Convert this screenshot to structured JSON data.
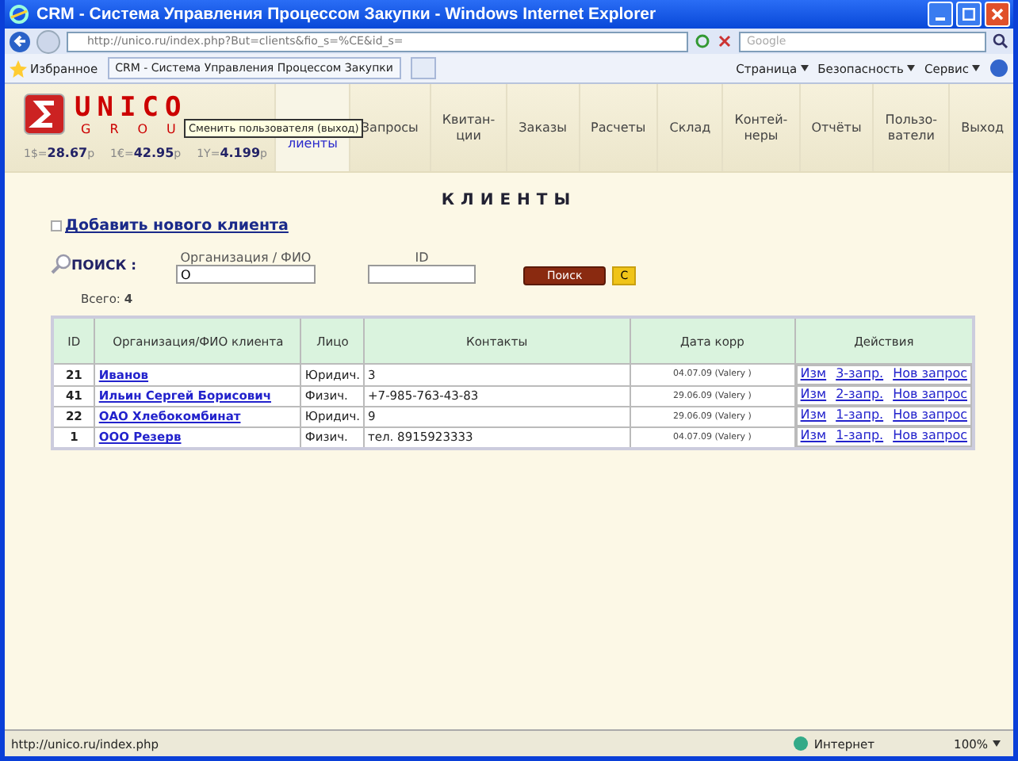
{
  "window": {
    "title": "CRM - Система Управления Процессом Закупки - Windows Internet Explorer"
  },
  "browser": {
    "address": "http://unico.ru/index.php?But=clients&fio_s=%CE&id_s=",
    "search_placeholder": "Google",
    "favorites": "Избранное",
    "tab_title": "CRM - Система Управления Процессом Закупки",
    "commands": [
      "Страница",
      "Безопасность",
      "Сервис"
    ]
  },
  "header": {
    "logo_main": "UNICO",
    "logo_sub": "GROU",
    "rates": [
      {
        "label": "1$=",
        "value": "28.67",
        "unit": "р"
      },
      {
        "label": "1€=",
        "value": "42.95",
        "unit": "р"
      },
      {
        "label": "1Y=",
        "value": "4.199",
        "unit": "р"
      }
    ],
    "tooltip": "Сменить пользователя (выход)",
    "nav": [
      {
        "label": "лиенты",
        "selected": true
      },
      {
        "label": "Запросы",
        "selected": false
      },
      {
        "label": "Квитан-\nции",
        "selected": false
      },
      {
        "label": "Заказы",
        "selected": false
      },
      {
        "label": "Расчеты",
        "selected": false
      },
      {
        "label": "Склад",
        "selected": false
      },
      {
        "label": "Контей-\nнеры",
        "selected": false
      },
      {
        "label": "Отчёты",
        "selected": false
      },
      {
        "label": "Пользо-\nватели",
        "selected": false
      },
      {
        "label": "Выход",
        "selected": false
      }
    ]
  },
  "page": {
    "title": "КЛИЕНТЫ",
    "add_link": "Добавить нового клиента",
    "search_label": "ПОИСК :",
    "org_label": "Организация / ФИО",
    "org_value": "О",
    "id_label": "ID",
    "search_button": "Поиск",
    "clear_button": "С",
    "total_label": "Всего:",
    "total_value": "4"
  },
  "table": {
    "columns": [
      "ID",
      "Организация/ФИО клиента",
      "Лицо",
      "Контакты",
      "Дата корр",
      "Действия"
    ],
    "rows": [
      {
        "id": "21",
        "name": "Иванов",
        "type": "Юридич.",
        "contacts": "3",
        "date": "04.07.09 (Valery )",
        "edit": "Изм",
        "requests": "3-запр.",
        "new": "Нов запрос"
      },
      {
        "id": "41",
        "name": "Ильин Сергей Борисович",
        "type": "Физич.",
        "contacts": "+7-985-763-43-83",
        "date": "29.06.09 (Valery )",
        "edit": "Изм",
        "requests": "2-запр.",
        "new": "Нов запрос"
      },
      {
        "id": "22",
        "name": "ОАО Хлебокомбинат",
        "type": "Юридич.",
        "contacts": "9",
        "date": "29.06.09 (Valery )",
        "edit": "Изм",
        "requests": "1-запр.",
        "new": "Нов запрос"
      },
      {
        "id": "1",
        "name": "ООО Резерв",
        "type": "Физич.",
        "contacts": "тел. 8915923333",
        "date": "04.07.09 (Valery )",
        "edit": "Изм",
        "requests": "1-запр.",
        "new": "Нов запрос"
      }
    ]
  },
  "status_bar": {
    "url": "http://unico.ru/index.php",
    "zone": "Интернет",
    "zoom": "100%"
  }
}
